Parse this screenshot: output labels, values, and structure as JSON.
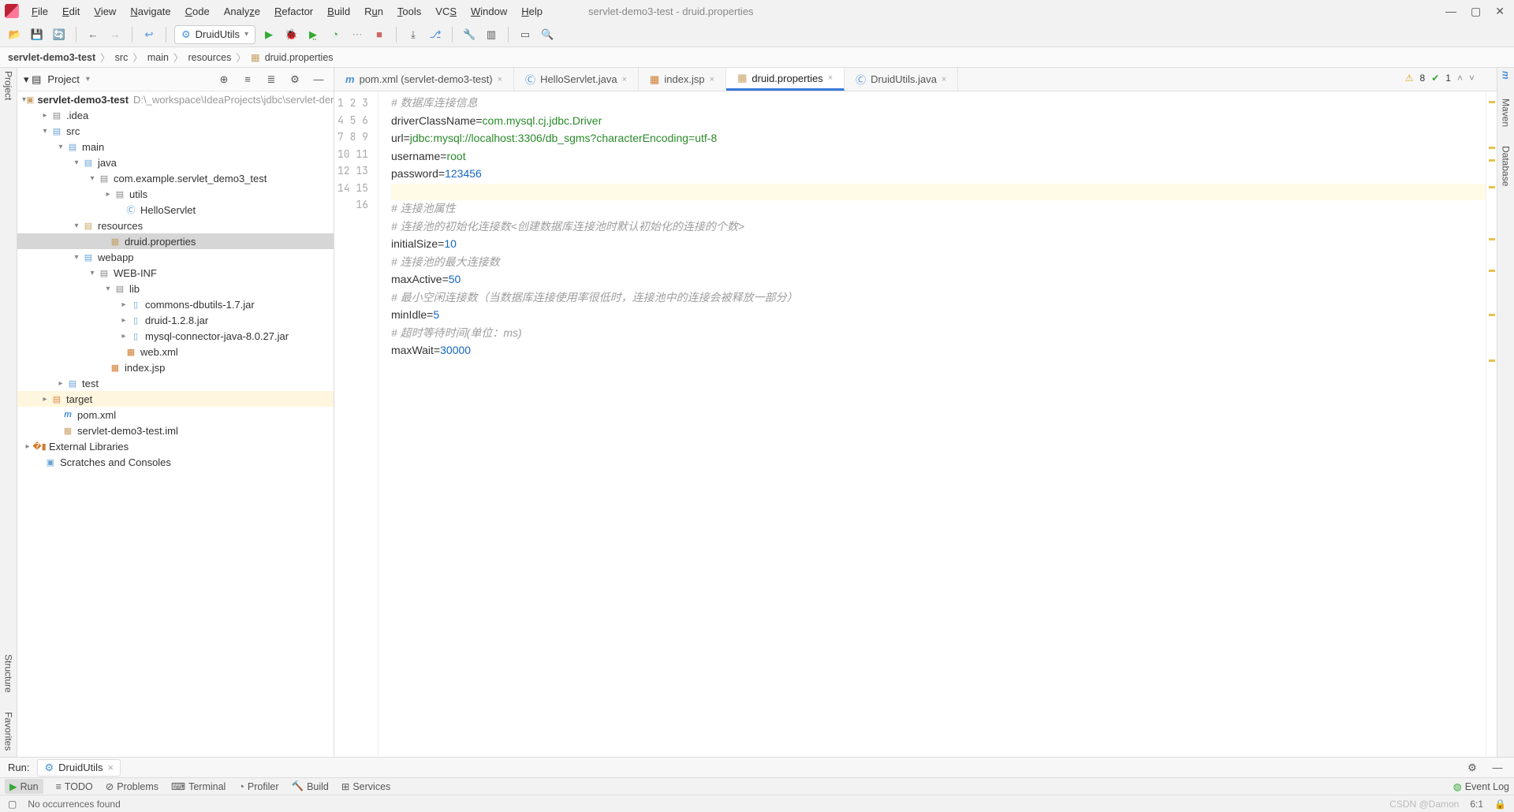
{
  "window_title": "servlet-demo3-test - druid.properties",
  "menu": [
    "File",
    "Edit",
    "View",
    "Navigate",
    "Code",
    "Analyze",
    "Refactor",
    "Build",
    "Run",
    "Tools",
    "VCS",
    "Window",
    "Help"
  ],
  "run_config": "DruidUtils",
  "breadcrumb": [
    "servlet-demo3-test",
    "src",
    "main",
    "resources",
    "druid.properties"
  ],
  "project_panel": {
    "title": "Project",
    "root": {
      "name": "servlet-demo3-test",
      "path": "D:\\_workspace\\IdeaProjects\\jdbc\\servlet-demo"
    },
    "ext_libs": "External Libraries",
    "scratches": "Scratches and Consoles",
    "nodes": {
      "idea": ".idea",
      "src": "src",
      "main": "main",
      "java": "java",
      "pkg": "com.example.servlet_demo3_test",
      "utils_pkg": "utils",
      "hello": "HelloServlet",
      "resources": "resources",
      "druid": "druid.properties",
      "webapp": "webapp",
      "webinf": "WEB-INF",
      "lib": "lib",
      "lib1": "commons-dbutils-1.7.jar",
      "lib2": "druid-1.2.8.jar",
      "lib3": "mysql-connector-java-8.0.27.jar",
      "webxml": "web.xml",
      "indexjsp": "index.jsp",
      "test": "test",
      "target": "target",
      "pom": "pom.xml",
      "iml": "servlet-demo3-test.iml"
    }
  },
  "tabs": [
    {
      "label": "pom.xml (servlet-demo3-test)",
      "icon": "m"
    },
    {
      "label": "HelloServlet.java",
      "icon": "C"
    },
    {
      "label": "index.jsp",
      "icon": "jsp"
    },
    {
      "label": "druid.properties",
      "icon": "prop",
      "active": true
    },
    {
      "label": "DruidUtils.java",
      "icon": "C"
    }
  ],
  "inspections": {
    "warnings": "8",
    "ok": "1"
  },
  "code_tokens": {
    "l1": "# 数据库连接信息",
    "l2k": "driverClassName",
    "l2v": "com.mysql.cj.jdbc.Driver",
    "l3k": "url",
    "l3v": "jdbc:mysql://localhost:3306/db_sgms?characterEncoding=utf-8",
    "l4k": "username",
    "l4v": "root",
    "l5k": "password",
    "l5v": "123456",
    "l7": "# 连接池属性",
    "l8": "# 连接池的初始化连接数<创建数据库连接池时默认初始化的连接的个数>",
    "l9k": "initialSize",
    "l9v": "10",
    "l10": "# 连接池的最大连接数",
    "l11k": "maxActive",
    "l11v": "50",
    "l12": "# 最小空闲连接数（当数据库连接使用率很低时，连接池中的连接会被释放一部分）",
    "l13k": "minIdle",
    "l13v": "5",
    "l14": "# 超时等待时间(单位：ms)",
    "l15k": "maxWait",
    "l15v": "30000"
  },
  "run_tw": {
    "title": "Run:",
    "tab": "DruidUtils"
  },
  "bottom": [
    "Run",
    "TODO",
    "Problems",
    "Terminal",
    "Profiler",
    "Build",
    "Services"
  ],
  "event_log": "Event Log",
  "status": {
    "msg": "No occurrences found",
    "caret": "6:1",
    "watermark": "CSDN @Damon"
  },
  "left_stripe": [
    "Project",
    "Structure",
    "Favorites"
  ],
  "right_stripe": [
    "Maven",
    "Database"
  ],
  "eq": "="
}
